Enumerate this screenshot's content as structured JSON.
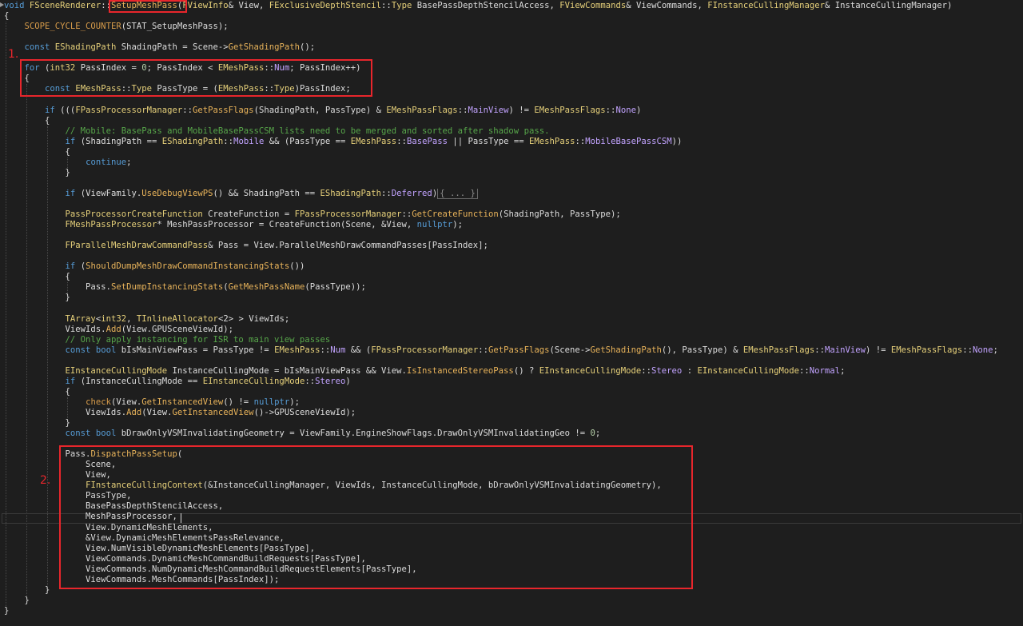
{
  "annotations": {
    "marker_1": "1.",
    "marker_2": "2."
  },
  "code_lines": [
    [
      [
        "t-kw",
        "void"
      ],
      [
        "t-plain",
        " "
      ],
      [
        "t-cls",
        "FSceneRenderer"
      ],
      [
        "t-plain",
        "::"
      ],
      [
        "t-fn",
        "SetupMeshPass"
      ],
      [
        "t-plain",
        "("
      ],
      [
        "t-cls",
        "FViewInfo"
      ],
      [
        "t-plain",
        "& View, "
      ],
      [
        "t-cls",
        "FExclusiveDepthStencil"
      ],
      [
        "t-plain",
        "::"
      ],
      [
        "t-cls",
        "Type"
      ],
      [
        "t-plain",
        " BasePassDepthStencilAccess, "
      ],
      [
        "t-cls",
        "FViewCommands"
      ],
      [
        "t-plain",
        "& ViewCommands, "
      ],
      [
        "t-cls",
        "FInstanceCullingManager"
      ],
      [
        "t-plain",
        "& InstanceCullingManager)"
      ]
    ],
    [
      [
        "t-plain",
        "{"
      ]
    ],
    [
      [
        "t-plain",
        "    "
      ],
      [
        "t-mac",
        "SCOPE_CYCLE_COUNTER"
      ],
      [
        "t-plain",
        "(STAT_SetupMeshPass);"
      ]
    ],
    [
      [
        "t-plain",
        ""
      ]
    ],
    [
      [
        "t-plain",
        "    "
      ],
      [
        "t-kw",
        "const"
      ],
      [
        "t-plain",
        " "
      ],
      [
        "t-cls",
        "EShadingPath"
      ],
      [
        "t-plain",
        " ShadingPath = Scene->"
      ],
      [
        "t-fn",
        "GetShadingPath"
      ],
      [
        "t-plain",
        "();"
      ]
    ],
    [
      [
        "t-plain",
        ""
      ]
    ],
    [
      [
        "t-plain",
        "    "
      ],
      [
        "t-kw",
        "for"
      ],
      [
        "t-plain",
        " ("
      ],
      [
        "t-cls",
        "int32"
      ],
      [
        "t-plain",
        " PassIndex = "
      ],
      [
        "t-num",
        "0"
      ],
      [
        "t-plain",
        "; PassIndex < "
      ],
      [
        "t-cls",
        "EMeshPass"
      ],
      [
        "t-plain",
        "::"
      ],
      [
        "t-enum",
        "Num"
      ],
      [
        "t-plain",
        "; PassIndex++)"
      ]
    ],
    [
      [
        "t-plain",
        "    {"
      ]
    ],
    [
      [
        "t-plain",
        "        "
      ],
      [
        "t-kw",
        "const"
      ],
      [
        "t-plain",
        " "
      ],
      [
        "t-cls",
        "EMeshPass"
      ],
      [
        "t-plain",
        "::"
      ],
      [
        "t-cls",
        "Type"
      ],
      [
        "t-plain",
        " PassType = ("
      ],
      [
        "t-cls",
        "EMeshPass"
      ],
      [
        "t-plain",
        "::"
      ],
      [
        "t-cls",
        "Type"
      ],
      [
        "t-plain",
        ")PassIndex;"
      ]
    ],
    [
      [
        "t-plain",
        ""
      ]
    ],
    [
      [
        "t-plain",
        "        "
      ],
      [
        "t-kw",
        "if"
      ],
      [
        "t-plain",
        " ((("
      ],
      [
        "t-cls",
        "FPassProcessorManager"
      ],
      [
        "t-plain",
        "::"
      ],
      [
        "t-fn",
        "GetPassFlags"
      ],
      [
        "t-plain",
        "(ShadingPath, PassType) & "
      ],
      [
        "t-cls",
        "EMeshPassFlags"
      ],
      [
        "t-plain",
        "::"
      ],
      [
        "t-enum",
        "MainView"
      ],
      [
        "t-plain",
        ") != "
      ],
      [
        "t-cls",
        "EMeshPassFlags"
      ],
      [
        "t-plain",
        "::"
      ],
      [
        "t-enum",
        "None"
      ],
      [
        "t-plain",
        ")"
      ]
    ],
    [
      [
        "t-plain",
        "        {"
      ]
    ],
    [
      [
        "t-plain",
        "            "
      ],
      [
        "t-cmt",
        "// Mobile: BasePass and MobileBasePassCSM lists need to be merged and sorted after shadow pass."
      ]
    ],
    [
      [
        "t-plain",
        "            "
      ],
      [
        "t-kw",
        "if"
      ],
      [
        "t-plain",
        " (ShadingPath == "
      ],
      [
        "t-cls",
        "EShadingPath"
      ],
      [
        "t-plain",
        "::"
      ],
      [
        "t-enum",
        "Mobile"
      ],
      [
        "t-plain",
        " && (PassType == "
      ],
      [
        "t-cls",
        "EMeshPass"
      ],
      [
        "t-plain",
        "::"
      ],
      [
        "t-enum",
        "BasePass"
      ],
      [
        "t-plain",
        " || PassType == "
      ],
      [
        "t-cls",
        "EMeshPass"
      ],
      [
        "t-plain",
        "::"
      ],
      [
        "t-enum",
        "MobileBasePassCSM"
      ],
      [
        "t-plain",
        "))"
      ]
    ],
    [
      [
        "t-plain",
        "            {"
      ]
    ],
    [
      [
        "t-plain",
        "                "
      ],
      [
        "t-kw",
        "continue"
      ],
      [
        "t-plain",
        ";"
      ]
    ],
    [
      [
        "t-plain",
        "            }"
      ]
    ],
    [
      [
        "t-plain",
        ""
      ]
    ],
    [
      [
        "t-plain",
        "            "
      ],
      [
        "t-kw",
        "if"
      ],
      [
        "t-plain",
        " (ViewFamily."
      ],
      [
        "t-fn",
        "UseDebugViewPS"
      ],
      [
        "t-plain",
        "() && ShadingPath == "
      ],
      [
        "t-cls",
        "EShadingPath"
      ],
      [
        "t-plain",
        "::"
      ],
      [
        "t-enum",
        "Deferred"
      ],
      [
        "t-plain",
        ")"
      ],
      [
        "t-fold",
        "{ ... }"
      ]
    ],
    [
      [
        "t-plain",
        ""
      ]
    ],
    [
      [
        "t-plain",
        "            "
      ],
      [
        "t-cls",
        "PassProcessorCreateFunction"
      ],
      [
        "t-plain",
        " CreateFunction = "
      ],
      [
        "t-cls",
        "FPassProcessorManager"
      ],
      [
        "t-plain",
        "::"
      ],
      [
        "t-fn",
        "GetCreateFunction"
      ],
      [
        "t-plain",
        "(ShadingPath, PassType);"
      ]
    ],
    [
      [
        "t-plain",
        "            "
      ],
      [
        "t-cls",
        "FMeshPassProcessor"
      ],
      [
        "t-plain",
        "* MeshPassProcessor = CreateFunction(Scene, &View, "
      ],
      [
        "t-kw",
        "nullptr"
      ],
      [
        "t-plain",
        ");"
      ]
    ],
    [
      [
        "t-plain",
        ""
      ]
    ],
    [
      [
        "t-plain",
        "            "
      ],
      [
        "t-cls",
        "FParallelMeshDrawCommandPass"
      ],
      [
        "t-plain",
        "& Pass = View.ParallelMeshDrawCommandPasses[PassIndex];"
      ]
    ],
    [
      [
        "t-plain",
        ""
      ]
    ],
    [
      [
        "t-plain",
        "            "
      ],
      [
        "t-kw",
        "if"
      ],
      [
        "t-plain",
        " ("
      ],
      [
        "t-fn",
        "ShouldDumpMeshDrawCommandInstancingStats"
      ],
      [
        "t-plain",
        "())"
      ]
    ],
    [
      [
        "t-plain",
        "            {"
      ]
    ],
    [
      [
        "t-plain",
        "                Pass."
      ],
      [
        "t-fn",
        "SetDumpInstancingStats"
      ],
      [
        "t-plain",
        "("
      ],
      [
        "t-fn",
        "GetMeshPassName"
      ],
      [
        "t-plain",
        "(PassType));"
      ]
    ],
    [
      [
        "t-plain",
        "            }"
      ]
    ],
    [
      [
        "t-plain",
        ""
      ]
    ],
    [
      [
        "t-plain",
        "            "
      ],
      [
        "t-cls",
        "TArray"
      ],
      [
        "t-plain",
        "<"
      ],
      [
        "t-cls",
        "int32"
      ],
      [
        "t-plain",
        ", "
      ],
      [
        "t-cls",
        "TInlineAllocator"
      ],
      [
        "t-plain",
        "<2> > ViewIds;"
      ]
    ],
    [
      [
        "t-plain",
        "            ViewIds."
      ],
      [
        "t-fn",
        "Add"
      ],
      [
        "t-plain",
        "(View.GPUSceneViewId);"
      ]
    ],
    [
      [
        "t-plain",
        "            "
      ],
      [
        "t-cmt",
        "// Only apply instancing for ISR to main view passes"
      ]
    ],
    [
      [
        "t-plain",
        "            "
      ],
      [
        "t-kw",
        "const"
      ],
      [
        "t-plain",
        " "
      ],
      [
        "t-kw",
        "bool"
      ],
      [
        "t-plain",
        " bIsMainViewPass = PassType != "
      ],
      [
        "t-cls",
        "EMeshPass"
      ],
      [
        "t-plain",
        "::"
      ],
      [
        "t-enum",
        "Num"
      ],
      [
        "t-plain",
        " && ("
      ],
      [
        "t-cls",
        "FPassProcessorManager"
      ],
      [
        "t-plain",
        "::"
      ],
      [
        "t-fn",
        "GetPassFlags"
      ],
      [
        "t-plain",
        "(Scene->"
      ],
      [
        "t-fn",
        "GetShadingPath"
      ],
      [
        "t-plain",
        "(), PassType) & "
      ],
      [
        "t-cls",
        "EMeshPassFlags"
      ],
      [
        "t-plain",
        "::"
      ],
      [
        "t-enum",
        "MainView"
      ],
      [
        "t-plain",
        ") != "
      ],
      [
        "t-cls",
        "EMeshPassFlags"
      ],
      [
        "t-plain",
        "::"
      ],
      [
        "t-enum",
        "None"
      ],
      [
        "t-plain",
        ";"
      ]
    ],
    [
      [
        "t-plain",
        ""
      ]
    ],
    [
      [
        "t-plain",
        "            "
      ],
      [
        "t-cls",
        "EInstanceCullingMode"
      ],
      [
        "t-plain",
        " InstanceCullingMode = bIsMainViewPass && View."
      ],
      [
        "t-fn",
        "IsInstancedStereoPass"
      ],
      [
        "t-plain",
        "() ? "
      ],
      [
        "t-cls",
        "EInstanceCullingMode"
      ],
      [
        "t-plain",
        "::"
      ],
      [
        "t-enum",
        "Stereo"
      ],
      [
        "t-plain",
        " : "
      ],
      [
        "t-cls",
        "EInstanceCullingMode"
      ],
      [
        "t-plain",
        "::"
      ],
      [
        "t-enum",
        "Normal"
      ],
      [
        "t-plain",
        ";"
      ]
    ],
    [
      [
        "t-plain",
        "            "
      ],
      [
        "t-kw",
        "if"
      ],
      [
        "t-plain",
        " (InstanceCullingMode == "
      ],
      [
        "t-cls",
        "EInstanceCullingMode"
      ],
      [
        "t-plain",
        "::"
      ],
      [
        "t-enum",
        "Stereo"
      ],
      [
        "t-plain",
        ")"
      ]
    ],
    [
      [
        "t-plain",
        "            {"
      ]
    ],
    [
      [
        "t-plain",
        "                "
      ],
      [
        "t-mac",
        "check"
      ],
      [
        "t-plain",
        "(View."
      ],
      [
        "t-fn",
        "GetInstancedView"
      ],
      [
        "t-plain",
        "() != "
      ],
      [
        "t-kw",
        "nullptr"
      ],
      [
        "t-plain",
        ");"
      ]
    ],
    [
      [
        "t-plain",
        "                ViewIds."
      ],
      [
        "t-fn",
        "Add"
      ],
      [
        "t-plain",
        "(View."
      ],
      [
        "t-fn",
        "GetInstancedView"
      ],
      [
        "t-plain",
        "()->GPUSceneViewId);"
      ]
    ],
    [
      [
        "t-plain",
        "            }"
      ]
    ],
    [
      [
        "t-plain",
        "            "
      ],
      [
        "t-kw",
        "const"
      ],
      [
        "t-plain",
        " "
      ],
      [
        "t-kw",
        "bool"
      ],
      [
        "t-plain",
        " bDrawOnlyVSMInvalidatingGeometry = ViewFamily.EngineShowFlags.DrawOnlyVSMInvalidatingGeo != "
      ],
      [
        "t-num",
        "0"
      ],
      [
        "t-plain",
        ";"
      ]
    ],
    [
      [
        "t-plain",
        ""
      ]
    ],
    [
      [
        "t-plain",
        "            Pass."
      ],
      [
        "t-fn",
        "DispatchPassSetup"
      ],
      [
        "t-plain",
        "("
      ]
    ],
    [
      [
        "t-plain",
        "                Scene,"
      ]
    ],
    [
      [
        "t-plain",
        "                View,"
      ]
    ],
    [
      [
        "t-plain",
        "                "
      ],
      [
        "t-cls",
        "FInstanceCullingContext"
      ],
      [
        "t-plain",
        "(&InstanceCullingManager, ViewIds, InstanceCullingMode, bDrawOnlyVSMInvalidatingGeometry),"
      ]
    ],
    [
      [
        "t-plain",
        "                PassType,"
      ]
    ],
    [
      [
        "t-plain",
        "                BasePassDepthStencilAccess,"
      ]
    ],
    [
      [
        "t-plain",
        "                MeshPassProcessor,"
      ]
    ],
    [
      [
        "t-plain",
        "                View.DynamicMeshElements,"
      ]
    ],
    [
      [
        "t-plain",
        "                &View.DynamicMeshElementsPassRelevance,"
      ]
    ],
    [
      [
        "t-plain",
        "                View.NumVisibleDynamicMeshElements[PassType],"
      ]
    ],
    [
      [
        "t-plain",
        "                ViewCommands.DynamicMeshCommandBuildRequests[PassType],"
      ]
    ],
    [
      [
        "t-plain",
        "                ViewCommands.NumDynamicMeshCommandBuildRequestElements[PassType],"
      ]
    ],
    [
      [
        "t-plain",
        "                ViewCommands.MeshCommands[PassIndex]);"
      ]
    ],
    [
      [
        "t-plain",
        "        }"
      ]
    ],
    [
      [
        "t-plain",
        "    }"
      ]
    ],
    [
      [
        "t-plain",
        "}"
      ]
    ]
  ]
}
